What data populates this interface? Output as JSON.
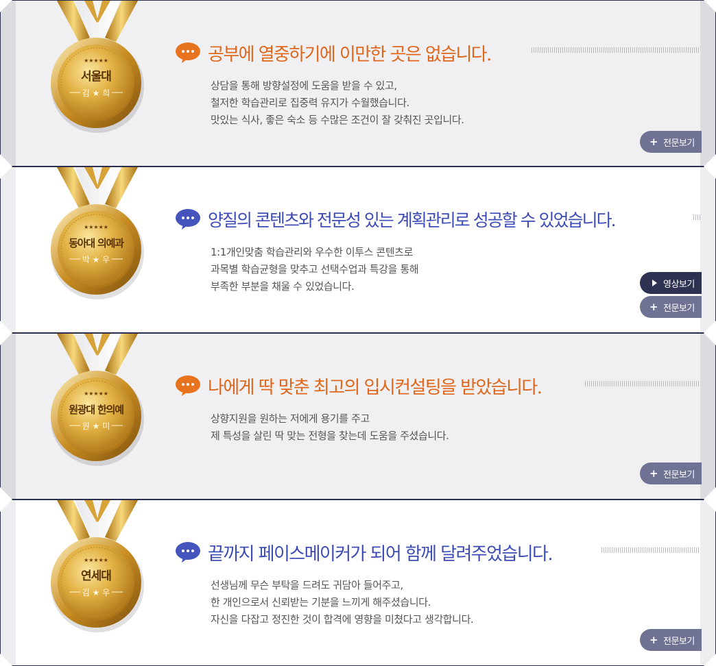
{
  "testimonials": [
    {
      "school": "서울대",
      "name": "김 ★ 희",
      "stars": "★★★★★",
      "headline": "공부에 열중하기에 이만한 곳은 없습니다.",
      "lines": [
        "상담을 통해 방향설정에 도움을 받을 수 있고,",
        "철저한 학습관리로 집중력 유지가 수월했습니다.",
        "맛있는 식사, 좋은 숙소 등 수많은 조건이 잘 갖춰진 곳입니다."
      ],
      "more_label": "전문보기"
    },
    {
      "school": "동아대 의예과",
      "name": "박 ★ 우",
      "stars": "★★★★★",
      "headline": "양질의 콘텐츠와 전문성 있는 계획관리로 성공할 수 있었습니다.",
      "lines": [
        "1:1개인맞춤 학습관리와 우수한 이투스 콘텐츠로",
        "과목별 학습균형을 맞추고 선택수업과 특강을 통해",
        "부족한 부분을 채울 수 있었습니다."
      ],
      "video_label": "영상보기",
      "more_label": "전문보기"
    },
    {
      "school": "원광대 한의예",
      "name": "원 ★ 미",
      "stars": "★★★★★",
      "headline": "나에게 딱 맞춘 최고의 입시컨설팅을 받았습니다.",
      "lines": [
        "상향지원을 원하는 저에게 용기를 주고",
        "제 특성을 살린 딱 맞는 전형을 찾는데 도움을 주셨습니다."
      ],
      "more_label": "전문보기"
    },
    {
      "school": "연세대",
      "name": "김 ★ 우",
      "stars": "★★★★★",
      "headline": "끝까지 페이스메이커가 되어 함께 달려주었습니다.",
      "lines": [
        "선생님께 무슨 부탁을 드려도 귀담아 들어주고,",
        "한 개인으로서 신뢰받는 기분을 느끼게 해주셨습니다.",
        "자신을 다잡고 정진한 것이 합격에 영향을 미쳤다고 생각합니다."
      ],
      "more_label": "전문보기"
    }
  ],
  "colors": {
    "headline_orange": "#e0661b",
    "headline_blue": "#3d4bb6",
    "bubble_orange": "#e8731f",
    "bubble_blue": "#4654be",
    "button_full": "#6f7293",
    "button_video": "#2e3250",
    "medal_gold": "#d9a530"
  },
  "icons": {
    "speech": "speech-bubble-icon",
    "plus": "plus-icon",
    "play": "play-icon",
    "medal": "gold-medal-icon"
  }
}
